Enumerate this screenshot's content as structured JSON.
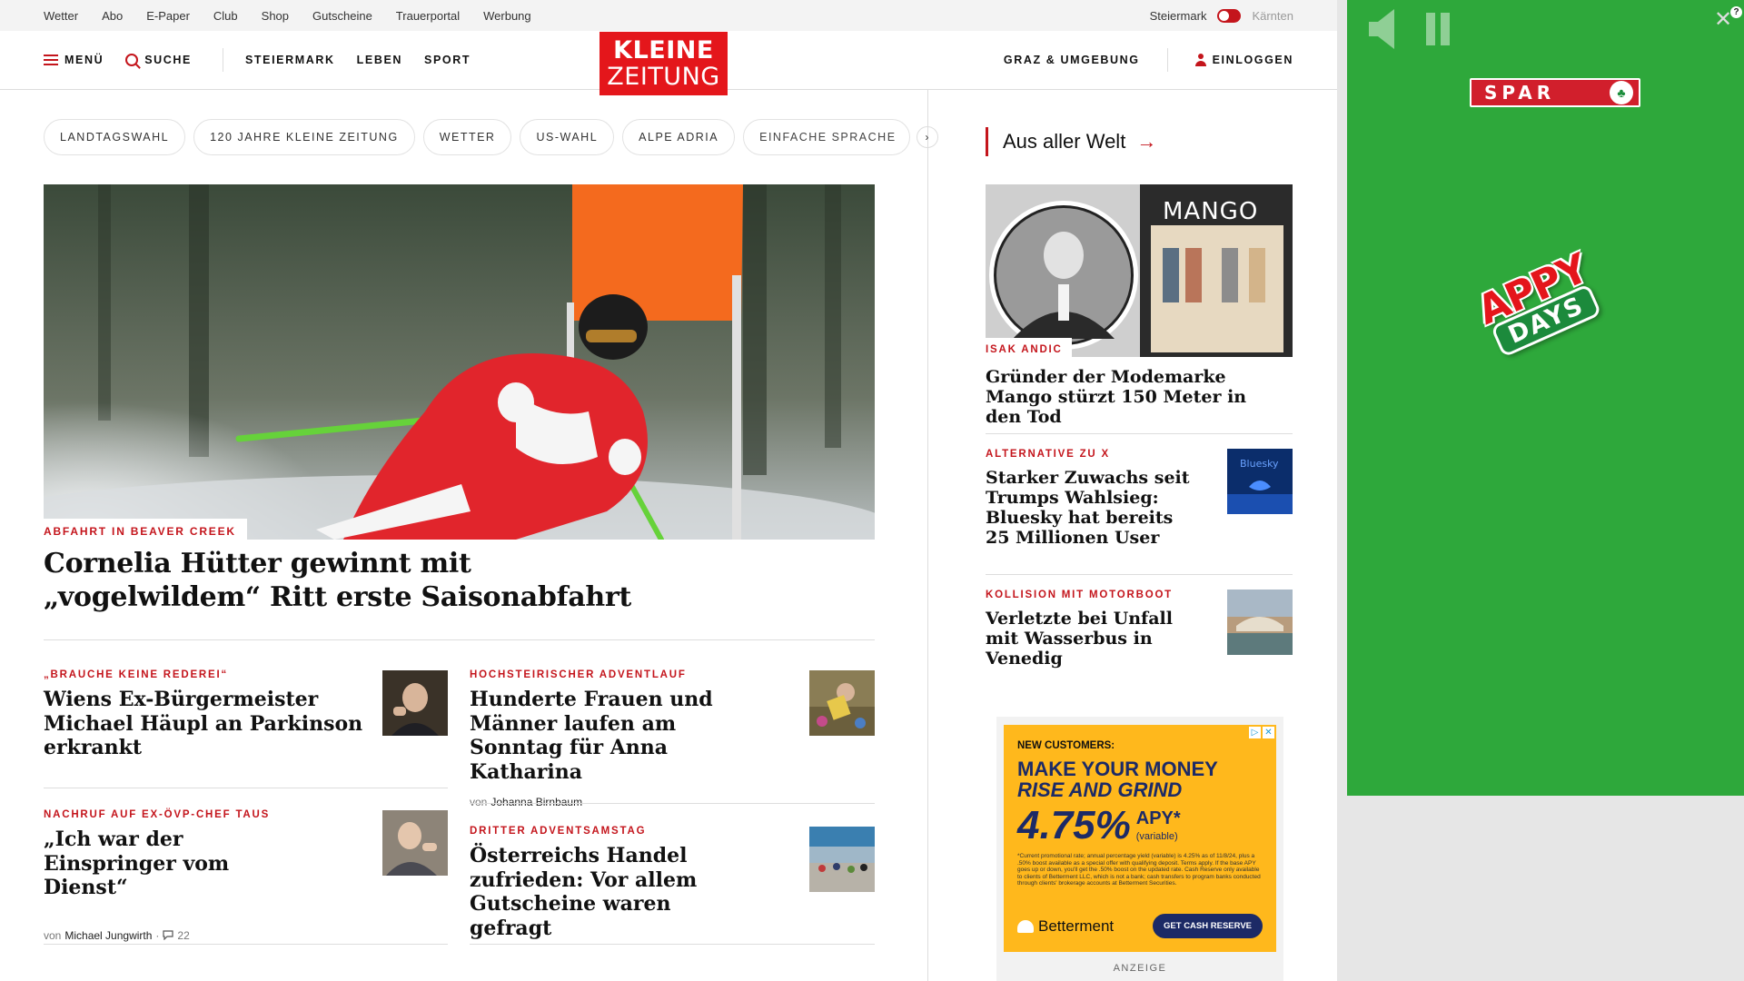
{
  "utility_bar": {
    "links": [
      "Wetter",
      "Abo",
      "E-Paper",
      "Club",
      "Shop",
      "Gutscheine",
      "Trauerportal",
      "Werbung"
    ],
    "region_active": "Steiermark",
    "region_inactive": "Kärnten"
  },
  "nav": {
    "menu": "MENÜ",
    "search": "SUCHE",
    "sections": [
      "STEIERMARK",
      "LEBEN",
      "SPORT"
    ],
    "logo_line1": "KLEINE",
    "logo_line2": "ZEITUNG",
    "region_link": "GRAZ & UMGEBUNG",
    "login": "EINLOGGEN"
  },
  "topics": {
    "items": [
      "LANDTAGSWAHL",
      "120 JAHRE KLEINE ZEITUNG",
      "WETTER",
      "US-WAHL",
      "ALPE ADRIA",
      "EINFACHE SPRACHE"
    ],
    "arrow": "›"
  },
  "hero": {
    "kicker": "ABFAHRT IN BEAVER CREEK",
    "title_line1": "Cornelia Hütter gewinnt mit",
    "title_line2": "„vogelwildem“ Ritt erste Saisonabfahrt"
  },
  "teasers": [
    {
      "kicker": "„BRAUCHE KEINE REDEREI“",
      "title": "Wiens Ex-Bürgermeister Michael Häupl an Parkinson erkrankt"
    },
    {
      "kicker": "HOCHSTEIRISCHER ADVENTLAUF",
      "title": "Hunderte Frauen und Männer laufen am Sonntag für Anna Katharina",
      "byline_prefix": "von",
      "byline_author": "Johanna Birnbaum"
    },
    {
      "kicker": "NACHRUF AUF EX-ÖVP-CHEF TAUS",
      "title": "„Ich war der Einspringer vom Dienst“",
      "byline_prefix": "von",
      "byline_author": "Michael Jungwirth",
      "comments": "22"
    },
    {
      "kicker": "DRITTER ADVENTSAMSTAG",
      "title": "Österreichs Handel zufrieden: Vor allem Gutscheine waren gefragt"
    }
  ],
  "sidebar": {
    "heading": "Aus aller Welt",
    "arrow": "→",
    "items": [
      {
        "kicker": "ISAK ANDIC",
        "title": "Gründer der Modemarke Mango stürzt 150 Meter in den Tod",
        "image_text": "MANGO"
      },
      {
        "kicker": "ALTERNATIVE ZU X",
        "title": "Starker Zuwachs seit Trumps Wahlsieg: Bluesky hat bereits 25 Millionen User",
        "image_text": "Bluesky"
      },
      {
        "kicker": "KOLLISION MIT MOTORBOOT",
        "title": "Verletzte bei Unfall mit Wasserbus in Venedig"
      }
    ]
  },
  "display_ad": {
    "label_new": "NEW CUSTOMERS:",
    "headline1": "MAKE YOUR MONEY",
    "headline2": "RISE AND GRIND",
    "rate": "4.75%",
    "apy": "APY*",
    "apy_note": "(variable)",
    "fine_print": "*Current promotional rate; annual percentage yield (variable) is 4.25% as of 11/8/24, plus a .50% boost available as a special offer with qualifying deposit. Terms apply. If the base APY goes up or down, you'll get the .50% boost on the updated rate. Cash Reserve only available to clients of Betterment LLC, which is not a bank; cash transfers to program banks conducted through clients' brokerage accounts at Betterment Securities.",
    "brand": "Betterment",
    "cta": "GET CASH RESERVE",
    "ad_label": "ANZEIGE"
  },
  "overlay_ad": {
    "brand": "SPAR",
    "promo_line1": "APPY",
    "promo_line2": "DAYS",
    "close": "✕",
    "help": "?"
  },
  "colors": {
    "brand_red": "#e4161b",
    "kicker_red": "#c4151c",
    "overlay_green": "#2ea83b",
    "ad_yellow": "#ffb81c",
    "ad_navy": "#1c2a66"
  }
}
